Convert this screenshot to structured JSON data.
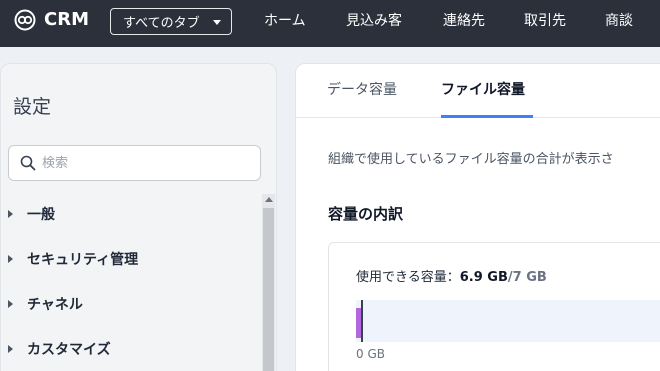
{
  "app": {
    "name": "CRM"
  },
  "topnav": {
    "tabs_button_label": "すべてのタブ",
    "items": [
      "ホーム",
      "見込み客",
      "連絡先",
      "取引先",
      "商談"
    ]
  },
  "sidebar": {
    "title": "設定",
    "search_placeholder": "検索",
    "items": [
      {
        "label": "一般"
      },
      {
        "label": "セキュリティ管理"
      },
      {
        "label": "チャネル"
      },
      {
        "label": "カスタマイズ"
      }
    ]
  },
  "main": {
    "tabs": [
      {
        "label": "データ容量",
        "active": false
      },
      {
        "label": "ファイル容量",
        "active": true
      }
    ],
    "description": "組織で使用しているファイル容量の合計が表示さ",
    "section_title": "容量の内訳",
    "storage": {
      "available_label": "使用できる容量：",
      "used": "6.9 GB",
      "total": "/7 GB",
      "axis_start": "0 GB",
      "bar_color": "#b466e0"
    }
  },
  "colors": {
    "topbar": "#2b303b",
    "accent": "#3b82f6"
  }
}
